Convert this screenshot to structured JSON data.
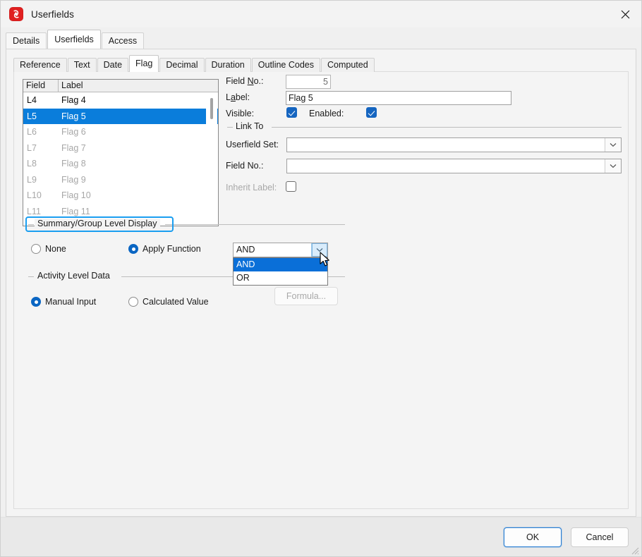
{
  "window": {
    "title": "Userfields",
    "icon": "app-logo-icon",
    "close_label": "×"
  },
  "outer_tabs": [
    {
      "label": "Details",
      "selected": false
    },
    {
      "label": "Userfields",
      "selected": true
    },
    {
      "label": "Access",
      "selected": false
    }
  ],
  "inner_tabs": [
    {
      "label": "Reference",
      "selected": false
    },
    {
      "label": "Text",
      "selected": false
    },
    {
      "label": "Date",
      "selected": false
    },
    {
      "label": "Flag",
      "selected": true
    },
    {
      "label": "Decimal",
      "selected": false
    },
    {
      "label": "Duration",
      "selected": false
    },
    {
      "label": "Outline Codes",
      "selected": false
    },
    {
      "label": "Computed",
      "selected": false
    }
  ],
  "field_list": {
    "columns": [
      "Field",
      "Label"
    ],
    "rows": [
      {
        "field": "L4",
        "label": "Flag 4",
        "state": "normal"
      },
      {
        "field": "L5",
        "label": "Flag 5",
        "state": "selected"
      },
      {
        "field": "L6",
        "label": "Flag 6",
        "state": "dim"
      },
      {
        "field": "L7",
        "label": "Flag 7",
        "state": "dim"
      },
      {
        "field": "L8",
        "label": "Flag 8",
        "state": "dim"
      },
      {
        "field": "L9",
        "label": "Flag 9",
        "state": "dim"
      },
      {
        "field": "L10",
        "label": "Flag 10",
        "state": "dim"
      },
      {
        "field": "L11",
        "label": "Flag 11",
        "state": "dim"
      }
    ]
  },
  "details": {
    "field_no_label_pre": "Field ",
    "field_no_label_accel": "N",
    "field_no_label_post": "o.:",
    "field_no_value": "5",
    "label_label_pre": "L",
    "label_label_accel": "a",
    "label_label_post": "bel:",
    "label_value": "Flag 5",
    "label_placeholder": "",
    "visible_label": "Visible:",
    "visible_checked": true,
    "enabled_label": "Enabled:",
    "enabled_checked": true
  },
  "link_to": {
    "caption": "Link To",
    "userfield_set_label": "Userfield Set:",
    "userfield_set_value": "",
    "field_no_label": "Field No.:",
    "field_no_value": "",
    "inherit_label_label": "Inherit Label:",
    "inherit_label_checked": false
  },
  "summary_group": {
    "caption": "Summary/Group Level Display",
    "highlighted": true,
    "options": [
      {
        "label": "None",
        "selected": false
      },
      {
        "label": "Apply Function",
        "selected": true
      }
    ],
    "function_combo": {
      "value": "AND",
      "open": true,
      "items": [
        {
          "label": "AND",
          "selected": true
        },
        {
          "label": "OR",
          "selected": false
        }
      ]
    }
  },
  "activity_level": {
    "caption": "Activity Level Data",
    "options": [
      {
        "label": "Manual Input",
        "selected": true
      },
      {
        "label": "Calculated Value",
        "selected": false
      }
    ],
    "formula_button": {
      "label": "Formula...",
      "disabled": true
    }
  },
  "footer": {
    "ok_label": "OK",
    "cancel_label": "Cancel"
  },
  "colors": {
    "accent_blue": "#0a7ddb",
    "highlight_ring": "#1a9ef0",
    "checkbox_blue": "#1565c0",
    "radio_blue": "#0b66c3",
    "app_icon_red": "#e02020",
    "window_bg": "#f0f0f0",
    "panel_bg": "#f4f4f4"
  }
}
